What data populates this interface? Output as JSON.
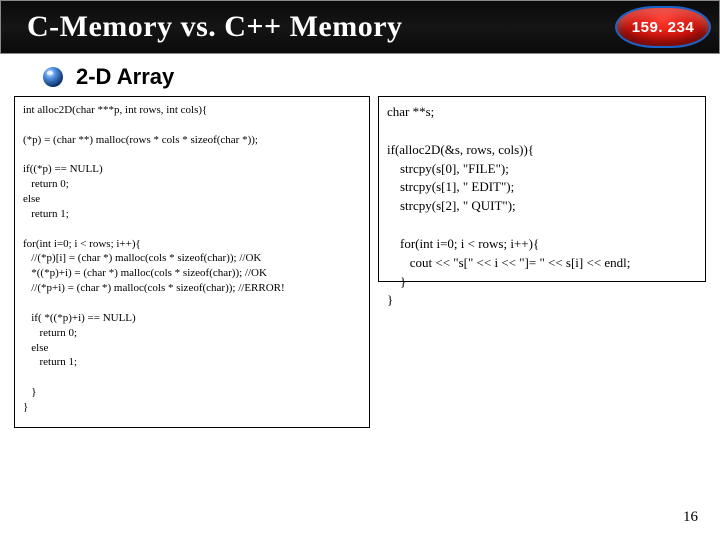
{
  "header": {
    "title": "C-Memory vs. C++ Memory",
    "course_code": "159. 234"
  },
  "section": {
    "title": "2-D Array"
  },
  "left_code": "int alloc2D(char ***p, int rows, int cols){\n\n(*p) = (char **) malloc(rows * cols * sizeof(char *));\n\nif((*p) == NULL)\n   return 0;\nelse\n   return 1;\n\nfor(int i=0; i < rows; i++){\n   //(*p)[i] = (char *) malloc(cols * sizeof(char)); //OK\n   *((*p)+i) = (char *) malloc(cols * sizeof(char)); //OK\n   //(*p+i) = (char *) malloc(cols * sizeof(char)); //ERROR!\n\n   if( *((*p)+i) == NULL)\n      return 0;\n   else\n      return 1;\n\n   }\n}",
  "right_code": "char **s;\n\nif(alloc2D(&s, rows, cols)){\n    strcpy(s[0], \"FILE\");\n    strcpy(s[1], \" EDIT\");\n    strcpy(s[2], \" QUIT\");\n\n    for(int i=0; i < rows; i++){\n       cout << \"s[\" << i << \"]= \" << s[i] << endl;\n    }\n}",
  "page_number": "16"
}
